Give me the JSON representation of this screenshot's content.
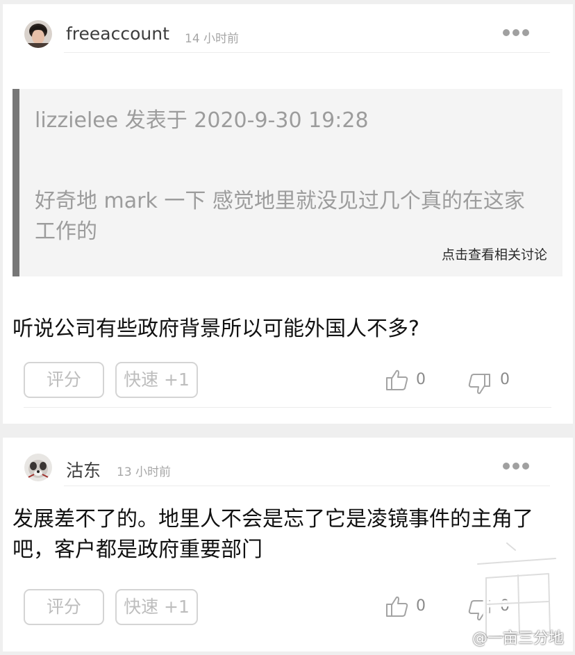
{
  "posts": [
    {
      "username": "freeaccount",
      "time": "14 小时前",
      "quote": {
        "meta": "lizzielee 发表于 2020-9-30 19:28",
        "text": "好奇地 mark 一下 感觉地里就没见过几个真的在这家工作的",
        "link": "点击查看相关讨论"
      },
      "body": "听说公司有些政府背景所以可能外国人不多?",
      "rate_label": "评分",
      "plus_label": "快速 +1",
      "likes": "0",
      "dislikes": "0"
    },
    {
      "username": "沽东",
      "time": "13 小时前",
      "body": "发展差不了的。地里人不会是忘了它是凌镜事件的主角了吧，客户都是政府重要部门",
      "rate_label": "评分",
      "plus_label": "快速 +1",
      "likes": "0",
      "dislikes": "0"
    }
  ],
  "watermark": "@一亩三分地",
  "icons": {
    "more": "more-dots-icon",
    "like": "thumbs-up-icon",
    "dislike": "thumbs-down-icon"
  }
}
